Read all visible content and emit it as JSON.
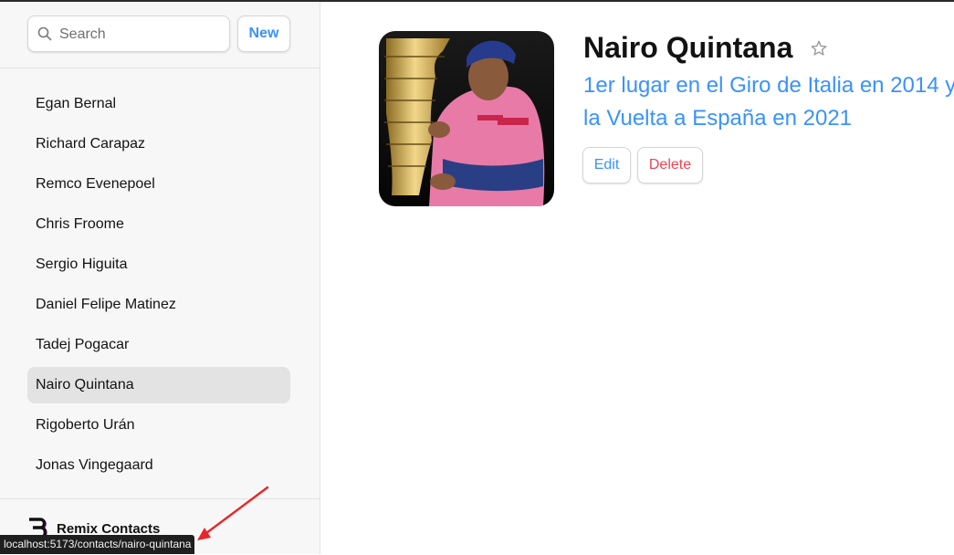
{
  "sidebar": {
    "search": {
      "placeholder": "Search",
      "value": ""
    },
    "new_button": "New",
    "contacts": [
      {
        "name": "Egan Bernal",
        "active": false
      },
      {
        "name": "Richard Carapaz",
        "active": false
      },
      {
        "name": "Remco Evenepoel",
        "active": false
      },
      {
        "name": "Chris Froome",
        "active": false
      },
      {
        "name": "Sergio Higuita",
        "active": false
      },
      {
        "name": "Daniel Felipe Matinez",
        "active": false
      },
      {
        "name": "Tadej Pogacar",
        "active": false
      },
      {
        "name": "Nairo Quintana",
        "active": true
      },
      {
        "name": "Rigoberto Urán",
        "active": false
      },
      {
        "name": "Jonas Vingegaard",
        "active": false
      }
    ],
    "footer": {
      "brand": "Remix Contacts"
    }
  },
  "status_bar": {
    "url": "localhost:5173/contacts/nairo-quintana"
  },
  "detail": {
    "name": "Nairo Quintana",
    "favorite": false,
    "description": "1er lugar en el Giro de Italia en 2014 y la Vuelta a España en 2021",
    "edit_label": "Edit",
    "delete_label": "Delete"
  },
  "colors": {
    "accent": "#3992ff",
    "danger": "#f44250",
    "active_item": "#e3e3e3",
    "sidebar_bg": "#f7f7f7",
    "annotation_arrow": "#e8262a"
  }
}
